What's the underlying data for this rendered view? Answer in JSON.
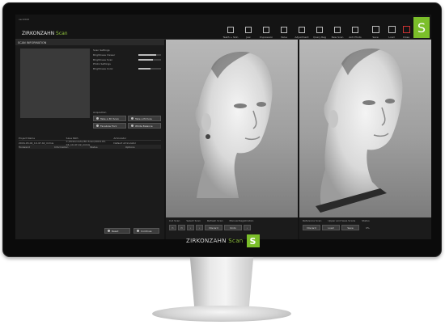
{
  "window": {
    "title_small": "ver.2022"
  },
  "app": {
    "brand": "ZIRKONZAHN",
    "brand_accent": "Scan",
    "logo_letter": "S",
    "accent_color": "#7bbf2a"
  },
  "toolbar": {
    "items": [
      {
        "label": "Teeth + Skin",
        "icon": "tooth-icon"
      },
      {
        "label": "Jaw",
        "icon": "jaw-icon"
      },
      {
        "label": "Impression",
        "icon": "impression-icon"
      },
      {
        "label": "Valve",
        "icon": "exclamation-icon"
      },
      {
        "label": "Adjustment",
        "icon": "sliders-icon"
      },
      {
        "label": "Query Reg",
        "icon": "grid-icon"
      },
      {
        "label": "New Scan",
        "icon": "scan-icon"
      },
      {
        "label": "Anti Photo",
        "icon": "photo-icon"
      }
    ],
    "save_label": "Save",
    "load_label": "Load",
    "close_label": "Close"
  },
  "left_panel": {
    "header": "SCAN INFORMATION",
    "settings": {
      "scan_settings": "Scan Settings",
      "brightness_viewer": "Brightness Viewer",
      "brightness_scan": "Brightness Scan",
      "photo_settings": "Photo Settings",
      "brightness_color": "Brightness Color",
      "values": {
        "viewer": 0.8,
        "scan": 0.65,
        "color": 0.55
      }
    },
    "acquisition": {
      "header": "Acquisition",
      "buttons": [
        "Take a 3D Scan",
        "Take a Picture",
        "Facebow Fork",
        "White Balance"
      ]
    },
    "table": {
      "headers": [
        "Project Name",
        "Save Path",
        "Articulator"
      ],
      "row": [
        "2016-03-04_10-47-42_mimis",
        "C:/Zirkonzahn/3D-Scan/2016-03-04_10-47-42_mimis",
        "Default Articulator"
      ],
      "sub_headers": [
        "Toolwand",
        "Information",
        "Status",
        "Options"
      ]
    },
    "bottom": {
      "reset_label": "Reset",
      "continue_label": "Continue"
    }
  },
  "bottom_left": {
    "labels": [
      "Cut Scan",
      "Select Scan",
      "Refresh Scan",
      "Manual Registration"
    ],
    "discard_label": "Discard",
    "undo_label": "Undo"
  },
  "bottom_right": {
    "labels": [
      "Reference Scan",
      "Upper and Save Scans",
      "Status"
    ],
    "discard_label": "Discard",
    "load_label": "Load",
    "save_label": "Save",
    "status_value": "0%"
  },
  "chin": {
    "brand": "ZIRKONZAHN",
    "brand_accent": "Scan",
    "logo_letter": "S"
  }
}
